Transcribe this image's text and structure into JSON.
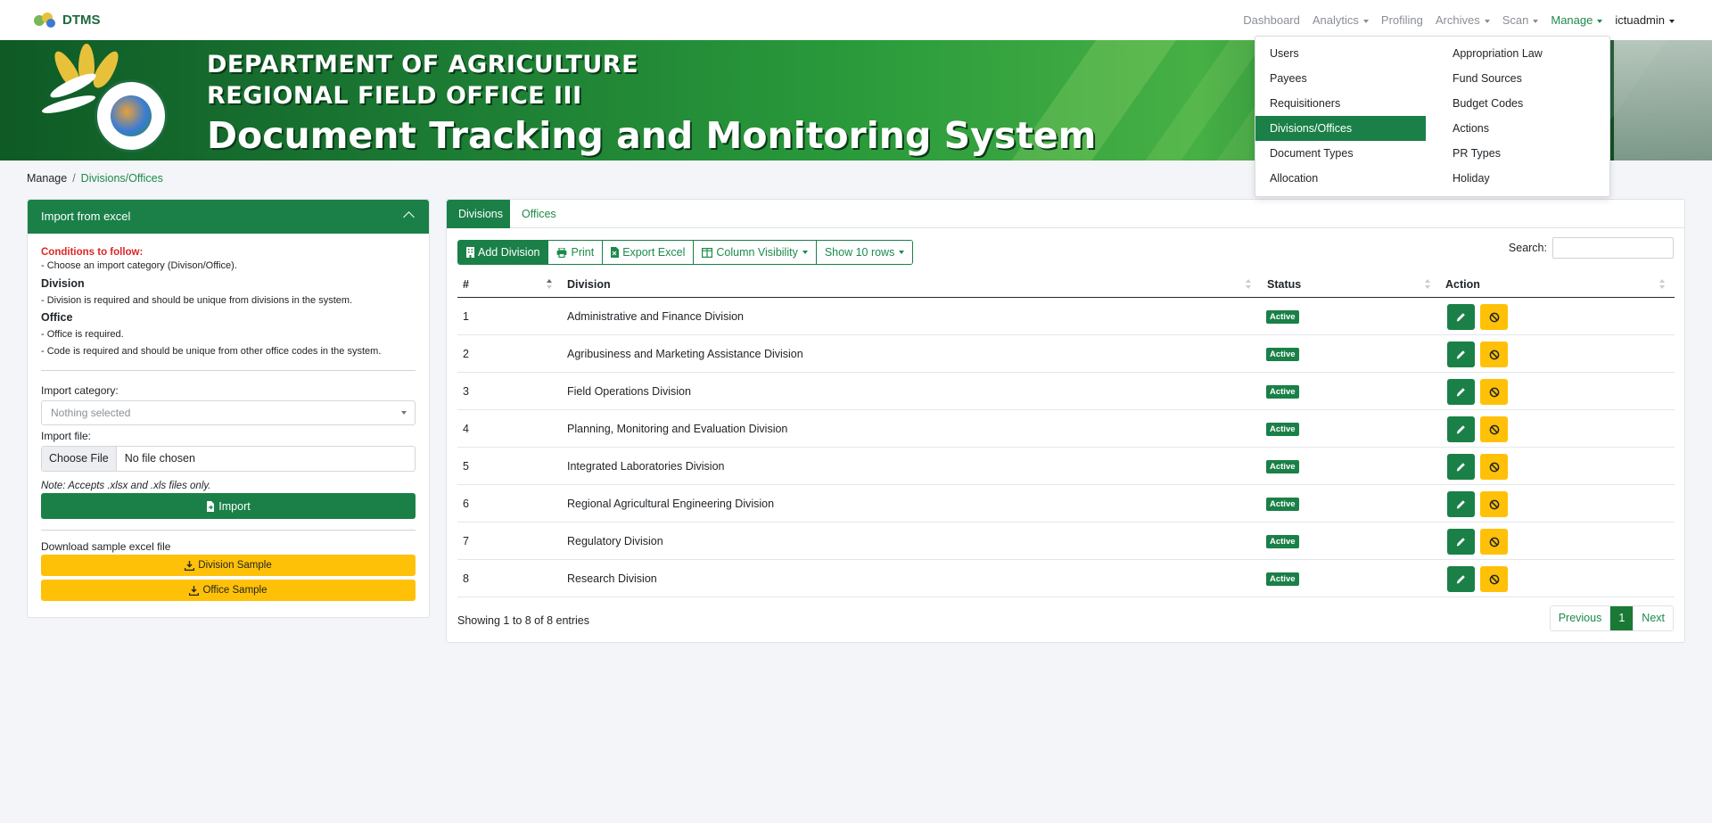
{
  "brand": {
    "name": "DTMS"
  },
  "nav": {
    "items": [
      {
        "label": "Dashboard",
        "dropdown": false,
        "active": false
      },
      {
        "label": "Analytics",
        "dropdown": true,
        "active": false
      },
      {
        "label": "Profiling",
        "dropdown": false,
        "active": false
      },
      {
        "label": "Archives",
        "dropdown": true,
        "active": false
      },
      {
        "label": "Scan",
        "dropdown": true,
        "active": false
      },
      {
        "label": "Manage",
        "dropdown": true,
        "active": true
      }
    ],
    "user": "ictuadmin"
  },
  "banner": {
    "line1": "DEPARTMENT OF AGRICULTURE",
    "line2": "REGIONAL FIELD OFFICE III",
    "line3": "Document Tracking and Monitoring System"
  },
  "manage_menu": {
    "left": [
      "Users",
      "Payees",
      "Requisitioners",
      "Divisions/Offices",
      "Document Types",
      "Allocation"
    ],
    "right": [
      "Appropriation Law",
      "Fund Sources",
      "Budget Codes",
      "Actions",
      "PR Types",
      "Holiday"
    ],
    "active": "Divisions/Offices"
  },
  "breadcrumb": {
    "parent": "Manage",
    "separator": "/",
    "current": "Divisions/Offices"
  },
  "import_card": {
    "title": "Import from excel",
    "conditions_title": "Conditions to follow:",
    "line_choose": "- Choose an import category (Divison/Office).",
    "division_heading": "Division",
    "division_rule": "- Division is required and should be unique from divisions in the system.",
    "office_heading": "Office",
    "office_rule1": "- Office is required.",
    "office_rule2": "- Code is required and should be unique from other office codes in the system.",
    "category_label": "Import category:",
    "category_placeholder": "Nothing selected",
    "file_label": "Import file:",
    "file_button": "Choose File",
    "file_status": "No file chosen",
    "note": "Note: Accepts .xlsx and .xls files only.",
    "import_button": "Import",
    "sample_label": "Download sample excel file",
    "division_sample": "Division Sample",
    "office_sample": "Office Sample"
  },
  "tabs": [
    {
      "label": "Divisions",
      "active": true
    },
    {
      "label": "Offices",
      "active": false
    }
  ],
  "toolbar": {
    "add": "Add Division",
    "print": "Print",
    "export": "Export Excel",
    "columns": "Column Visibility",
    "rows": "Show 10 rows"
  },
  "search": {
    "label": "Search:",
    "value": ""
  },
  "table": {
    "columns": [
      "#",
      "Division",
      "Status",
      "Action"
    ],
    "rows": [
      {
        "num": "1",
        "division": "Administrative and Finance Division",
        "status": "Active"
      },
      {
        "num": "2",
        "division": "Agribusiness and Marketing Assistance Division",
        "status": "Active"
      },
      {
        "num": "3",
        "division": "Field Operations Division",
        "status": "Active"
      },
      {
        "num": "4",
        "division": "Planning, Monitoring and Evaluation Division",
        "status": "Active"
      },
      {
        "num": "5",
        "division": "Integrated Laboratories Division",
        "status": "Active"
      },
      {
        "num": "6",
        "division": "Regional Agricultural Engineering Division",
        "status": "Active"
      },
      {
        "num": "7",
        "division": "Regulatory Division",
        "status": "Active"
      },
      {
        "num": "8",
        "division": "Research Division",
        "status": "Active"
      }
    ]
  },
  "footer": {
    "info": "Showing 1 to 8 of 8 entries",
    "previous": "Previous",
    "page": "1",
    "next": "Next"
  },
  "colors": {
    "primary_green": "#1a8048",
    "accent_yellow": "#ffc107",
    "warning_red": "#dc2626",
    "page_bg": "#f4f5f8"
  }
}
